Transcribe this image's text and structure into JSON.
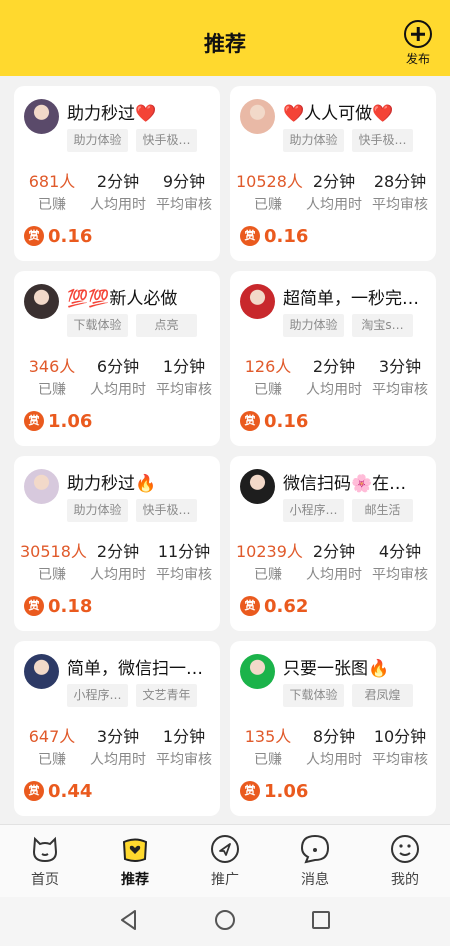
{
  "header": {
    "title": "推荐",
    "publish_label": "发布"
  },
  "stat_labels": {
    "earned": "已赚",
    "avg_time": "人均用时",
    "avg_review": "平均审核"
  },
  "reward_icon_label": "赏",
  "cards": [
    {
      "title": "助力秒过❤️",
      "tags": [
        "助力体验",
        "快手极…"
      ],
      "earned": "681人",
      "avg_time": "2分钟",
      "avg_review": "9分钟",
      "reward": "0.16",
      "avatar_color": "#5a4a6a"
    },
    {
      "title": "❤️人人可做❤️",
      "tags": [
        "助力体验",
        "快手极…"
      ],
      "earned": "10528人",
      "avg_time": "2分钟",
      "avg_review": "28分钟",
      "reward": "0.16",
      "avatar_color": "#e9b9a6"
    },
    {
      "title": "💯💯新人必做",
      "tags": [
        "下载体验",
        "点亮"
      ],
      "earned": "346人",
      "avg_time": "6分钟",
      "avg_review": "1分钟",
      "reward": "1.06",
      "avatar_color": "#3a3030"
    },
    {
      "title": "超简单，一秒完…",
      "tags": [
        "助力体验",
        "淘宝s…"
      ],
      "earned": "126人",
      "avg_time": "2分钟",
      "avg_review": "3分钟",
      "reward": "0.16",
      "avatar_color": "#c8282c"
    },
    {
      "title": "助力秒过🔥",
      "tags": [
        "助力体验",
        "快手极…"
      ],
      "earned": "30518人",
      "avg_time": "2分钟",
      "avg_review": "11分钟",
      "reward": "0.18",
      "avatar_color": "#d7c9dd"
    },
    {
      "title": "微信扫码🌸在…",
      "tags": [
        "小程序…",
        "邮生活"
      ],
      "earned": "10239人",
      "avg_time": "2分钟",
      "avg_review": "4分钟",
      "reward": "0.62",
      "avatar_color": "#1e1e1e"
    },
    {
      "title": "简单，微信扫一…",
      "tags": [
        "小程序…",
        "文艺青年"
      ],
      "earned": "647人",
      "avg_time": "3分钟",
      "avg_review": "1分钟",
      "reward": "0.44",
      "avatar_color": "#2d3a66"
    },
    {
      "title": "只要一张图🔥",
      "tags": [
        "下载体验",
        "君凤煌"
      ],
      "earned": "135人",
      "avg_time": "8分钟",
      "avg_review": "10分钟",
      "reward": "1.06",
      "avatar_color": "#1bb34a"
    }
  ],
  "tabs": [
    {
      "label": "首页",
      "icon": "cat-face-icon",
      "active": false
    },
    {
      "label": "推荐",
      "icon": "heart-bag-icon",
      "active": true
    },
    {
      "label": "推广",
      "icon": "send-circle-icon",
      "active": false
    },
    {
      "label": "消息",
      "icon": "chat-face-icon",
      "active": false
    },
    {
      "label": "我的",
      "icon": "smiley-icon",
      "active": false
    }
  ],
  "colors": {
    "brand_yellow": "#ffd92e",
    "earned_orange": "#e05a2b",
    "reward_orange": "#ea5a1e"
  }
}
